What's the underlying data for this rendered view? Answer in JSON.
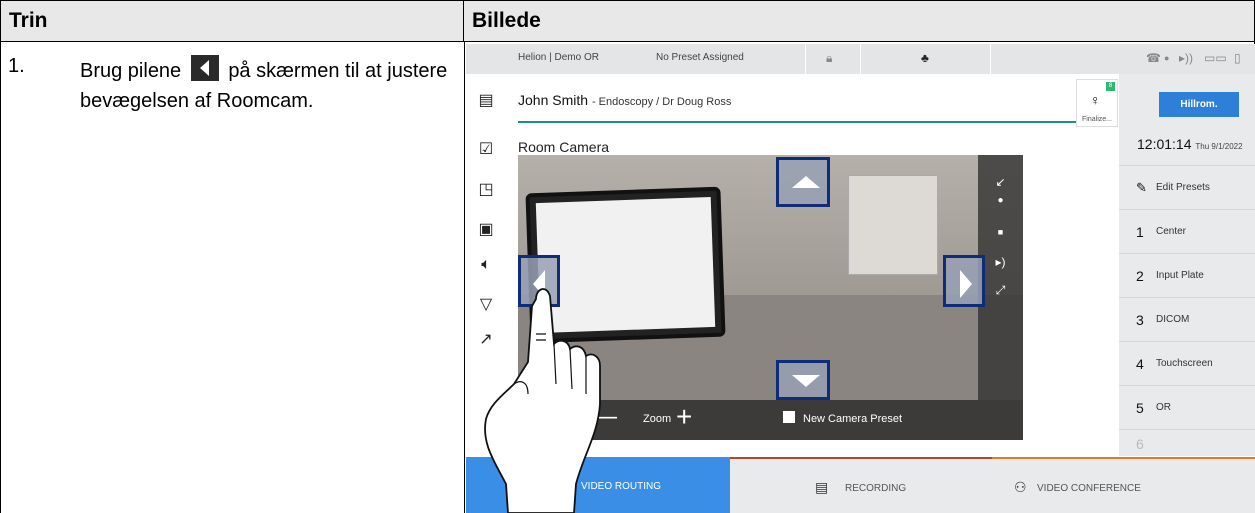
{
  "table": {
    "header_step": "Trin",
    "header_image": "Billede"
  },
  "step": {
    "number": "1.",
    "text_before": "Brug pilene",
    "text_after": "på skærmen til at justere bevægelsen af Roomcam."
  },
  "ui": {
    "statusbar": {
      "location": "Helion | Demo OR",
      "preset_status": "No Preset Assigned"
    },
    "patient": {
      "name": "John Smith",
      "details": "- Endoscopy / Dr Doug Ross"
    },
    "finalize_label": "Finalize...",
    "finalize_badge": "8",
    "brand": "Hillrom.",
    "clock": {
      "time": "12:01:14",
      "date": "Thu 9/1/2022"
    },
    "camera_title": "Room Camera",
    "camera_controls": {
      "zoom_label": "Zoom",
      "zoom_minus": "—",
      "zoom_plus": "+",
      "new_preset_label": "New Camera Preset"
    },
    "presets": {
      "edit_label": "Edit Presets",
      "items": [
        {
          "num": "1",
          "label": "Center"
        },
        {
          "num": "2",
          "label": "Input Plate"
        },
        {
          "num": "3",
          "label": "DICOM"
        },
        {
          "num": "4",
          "label": "Touchscreen"
        },
        {
          "num": "5",
          "label": "OR"
        },
        {
          "num": "6",
          "label": ""
        }
      ]
    },
    "tabs": [
      {
        "label": "VIDEO ROUTING",
        "color": "#3a8ee6"
      },
      {
        "label": "RECORDING",
        "color": "#e9eaeb"
      },
      {
        "label": "VIDEO CONFERENCE",
        "color": "#e9eaeb"
      }
    ],
    "accent_colors": {
      "teal": "#1a8f84",
      "brand_blue": "#2d7fd8",
      "arrow_border": "#0e2c78"
    }
  }
}
